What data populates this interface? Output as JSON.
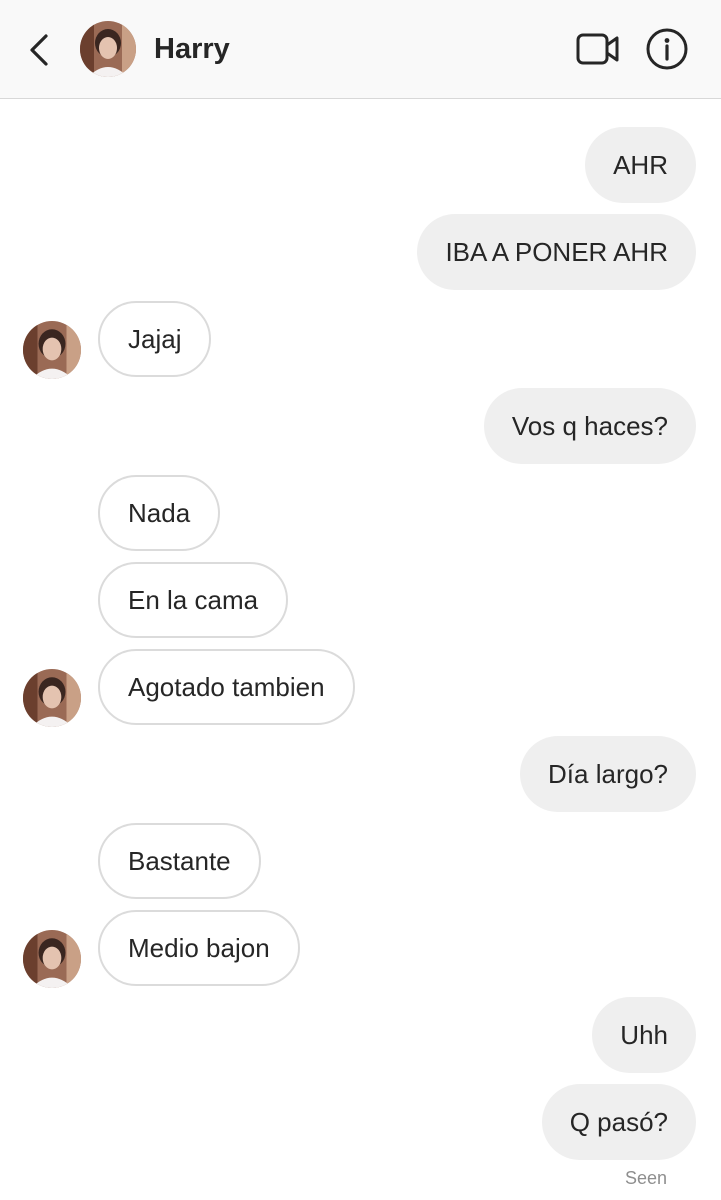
{
  "header": {
    "contact_name": "Harry",
    "icons": {
      "back": "chevron-left-icon",
      "video": "video-camera-icon",
      "info": "info-icon"
    }
  },
  "messages": [
    {
      "from": "me",
      "text": "AHR"
    },
    {
      "from": "me",
      "text": "IBA A PONER AHR"
    },
    {
      "from": "harry",
      "text": "Jajaj",
      "avatar": true
    },
    {
      "from": "me",
      "text": "Vos q haces?"
    },
    {
      "from": "harry",
      "text": "Nada",
      "avatar": false
    },
    {
      "from": "harry",
      "text": "En la cama",
      "avatar": false
    },
    {
      "from": "harry",
      "text": "Agotado tambien",
      "avatar": true
    },
    {
      "from": "me",
      "text": "Día largo?"
    },
    {
      "from": "harry",
      "text": "Bastante",
      "avatar": false
    },
    {
      "from": "harry",
      "text": "Medio bajon",
      "avatar": true
    },
    {
      "from": "me",
      "text": "Uhh"
    },
    {
      "from": "me",
      "text": "Q pasó?"
    }
  ],
  "status": {
    "seen_label": "Seen"
  },
  "colors": {
    "outgoing_bubble": "#efefef",
    "incoming_border": "#dbdbdb",
    "text": "#262626",
    "muted": "#8e8e8e"
  }
}
